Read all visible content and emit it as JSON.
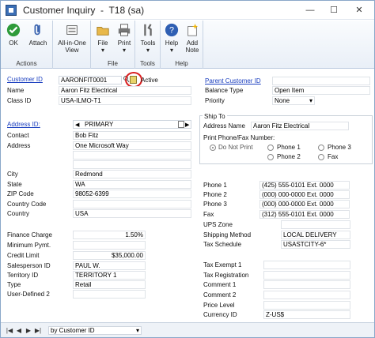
{
  "window": {
    "title": "Customer Inquiry  -  T18 (sa)",
    "minimize": "—",
    "maximize": "☐",
    "close": "✕"
  },
  "toolbar": {
    "ok": "OK",
    "attach": "Attach",
    "all_in_one": "All-in-One",
    "view": "View",
    "file": "File",
    "print": "Print",
    "tools": "Tools",
    "help": "Help",
    "add_note": "Add",
    "note": "Note",
    "group_actions": "Actions",
    "group_file": "File",
    "group_tools": "Tools",
    "group_help": "Help",
    "dropdown_marker": "▾"
  },
  "left": {
    "customer_id_label": "Customer ID",
    "customer_id": "AARONFIT0001",
    "active": "Active",
    "name_label": "Name",
    "name": "Aaron Fitz Electrical",
    "class_id_label": "Class ID",
    "class_id": "USA-ILMO-T1",
    "address_id_label": "Address ID:",
    "address_id": "PRIMARY",
    "contact_label": "Contact",
    "contact": "Bob Fitz",
    "address_label": "Address",
    "address": "One Microsoft Way",
    "city_label": "City",
    "city": "Redmond",
    "state_label": "State",
    "state": "WA",
    "zip_label": "ZIP Code",
    "zip": "98052-6399",
    "country_code_label": "Country Code",
    "country_code": "",
    "country_label": "Country",
    "country": "USA",
    "finance_charge_label": "Finance Charge",
    "finance_charge": "1.50%",
    "minimum_pymt_label": "Minimum Pymt.",
    "minimum_pymt": "",
    "credit_limit_label": "Credit Limit",
    "credit_limit": "$35,000.00",
    "salesperson_id_label": "Salesperson ID",
    "salesperson_id": "PAUL W.",
    "territory_id_label": "Territory ID",
    "territory_id": "TERRITORY 1",
    "type_label": "Type",
    "type": "Retail",
    "user_defined_2_label": "User-Defined 2",
    "user_defined_2": ""
  },
  "right": {
    "parent_customer_id_label": "Parent Customer ID",
    "parent_customer_id": "",
    "balance_type_label": "Balance Type",
    "balance_type": "Open Item",
    "priority_label": "Priority",
    "priority": "None",
    "ship_to_label": "Ship To",
    "address_name_label": "Address Name",
    "address_name": "Aaron Fitz Electrical",
    "print_phone_label": "Print Phone/Fax Number:",
    "do_not_print": "Do Not Print",
    "phone1_opt": "Phone 1",
    "phone2_opt": "Phone 2",
    "phone3_opt": "Phone 3",
    "fax_opt": "Fax",
    "phone1_label": "Phone 1",
    "phone1": "(425) 555-0101  Ext. 0000",
    "phone2_label": "Phone 2",
    "phone2": "(000) 000-0000  Ext. 0000",
    "phone3_label": "Phone 3",
    "phone3": "(000) 000-0000  Ext. 0000",
    "fax_label": "Fax",
    "fax": "(312) 555-0101  Ext. 0000",
    "ups_zone_label": "UPS Zone",
    "ups_zone": "",
    "shipping_method_label": "Shipping Method",
    "shipping_method": "LOCAL DELIVERY",
    "tax_schedule_label": "Tax Schedule",
    "tax_schedule": "USASTCITY-6*",
    "tax_exempt_label": "Tax Exempt 1",
    "tax_exempt": "",
    "tax_registration_label": "Tax Registration",
    "tax_registration": "",
    "comment1_label": "Comment 1",
    "comment1": "",
    "comment2_label": "Comment 2",
    "comment2": "",
    "price_level_label": "Price Level",
    "price_level": "",
    "currency_id_label": "Currency ID",
    "currency_id": "Z-US$"
  },
  "status": {
    "sort": "by Customer ID",
    "first": "|◀",
    "prev": "◀",
    "next": "▶",
    "last": "▶|",
    "sort_arrow": "▾"
  },
  "colors": {
    "link": "#1b3fbf",
    "highlight_circle": "#d92020"
  }
}
